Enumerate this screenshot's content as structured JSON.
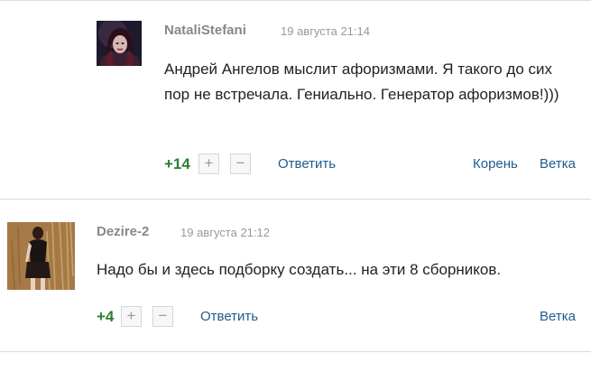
{
  "comments": [
    {
      "author": "NataliStefani",
      "date": "19 августа 21:14",
      "text": "Андрей Ангелов мыслит афоризмами. Я такого до сих пор не встречала. Гениально. Генератор афоризмов!)))",
      "score": "+14",
      "upvote_label": "+",
      "downvote_label": "−",
      "reply_label": "Ответить",
      "root_label": "Корень",
      "branch_label": "Ветка"
    },
    {
      "author": "Dezire-2",
      "date": "19 августа 21:12",
      "text": "Надо бы и здесь подборку создать... на эти 8 сборников.",
      "score": "+4",
      "upvote_label": "+",
      "downvote_label": "−",
      "reply_label": "Ответить",
      "branch_label": "Ветка"
    }
  ],
  "colors": {
    "score_positive": "#2e7d32",
    "link": "#1d5c8f",
    "author": "#888888",
    "date": "#999999"
  }
}
